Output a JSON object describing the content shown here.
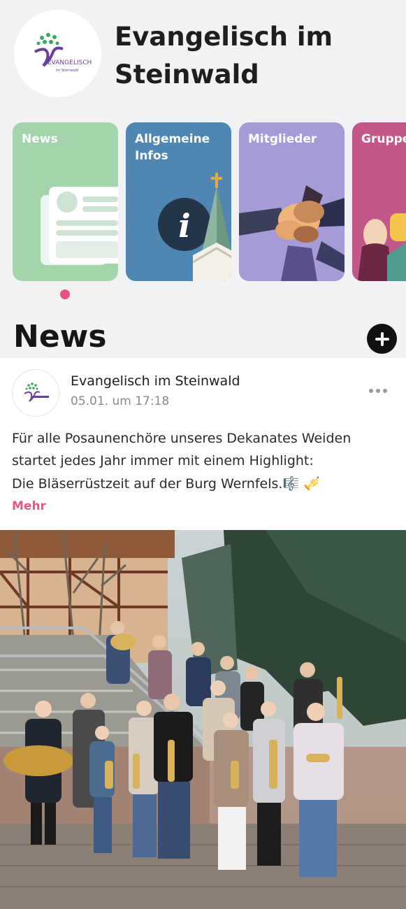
{
  "header": {
    "title": "Evangelisch im Steinwald",
    "logo_text": "EVANGELISCH",
    "logo_subtext": "im Steinwald"
  },
  "cards": [
    {
      "label": "News",
      "color": "#a4d4ac"
    },
    {
      "label": "Allgemeine Infos",
      "color": "#4f86b2"
    },
    {
      "label": "Mitglieder",
      "color": "#a59bd6"
    },
    {
      "label": "Gruppe",
      "color": "#c2588a"
    }
  ],
  "section": {
    "title": "News",
    "active_indicator_color": "#ee4f82"
  },
  "post": {
    "author": "Evangelisch im Steinwald",
    "time": "05.01. um 17:18",
    "text_line1": "Für alle Posaunenchöre unseres Dekanates Weiden",
    "text_line2": "startet jedes Jahr immer mit einem Highlight:",
    "text_line3": "Die Bläserrüstzeit auf der Burg Wernfels.🎼 🎺",
    "more_label": "Mehr",
    "more_color": "#e8578b",
    "image_icon": "group-photo-brass-band"
  }
}
